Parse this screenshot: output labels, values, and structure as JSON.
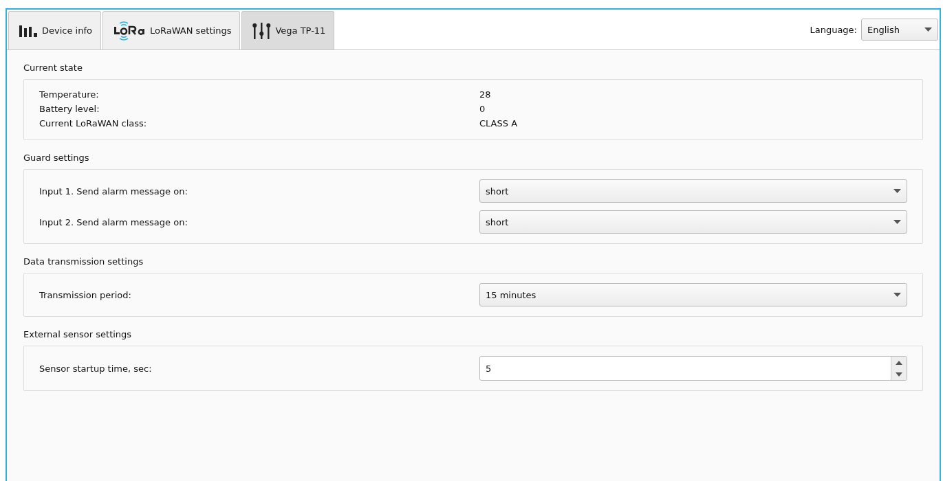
{
  "tabs": [
    {
      "label": "Device info",
      "kind": "bars",
      "selected": false
    },
    {
      "label": "LoRaWAN settings",
      "kind": "lora",
      "selected": false
    },
    {
      "label": "Vega TP-11",
      "kind": "sliders",
      "selected": true
    }
  ],
  "language": {
    "label": "Language:",
    "value": "English"
  },
  "sections": [
    {
      "title": "Current state",
      "rows": [
        {
          "kind": "info",
          "label": "Temperature:",
          "value": "28"
        },
        {
          "kind": "info",
          "label": "Battery level:",
          "value": "0"
        },
        {
          "kind": "info",
          "label": "Current LoRaWAN class:",
          "value": "CLASS A"
        }
      ]
    },
    {
      "title": "Guard settings",
      "rows": [
        {
          "kind": "select",
          "label": "Input 1. Send alarm message on:",
          "value": "short"
        },
        {
          "kind": "select",
          "label": "Input 2. Send alarm message on:",
          "value": "short"
        }
      ]
    },
    {
      "title": "Data transmission settings",
      "rows": [
        {
          "kind": "select",
          "label": "Transmission period:",
          "value": "15 minutes"
        }
      ]
    },
    {
      "title": "External sensor settings",
      "rows": [
        {
          "kind": "spin",
          "label": "Sensor startup time, sec:",
          "value": "5"
        }
      ]
    }
  ]
}
